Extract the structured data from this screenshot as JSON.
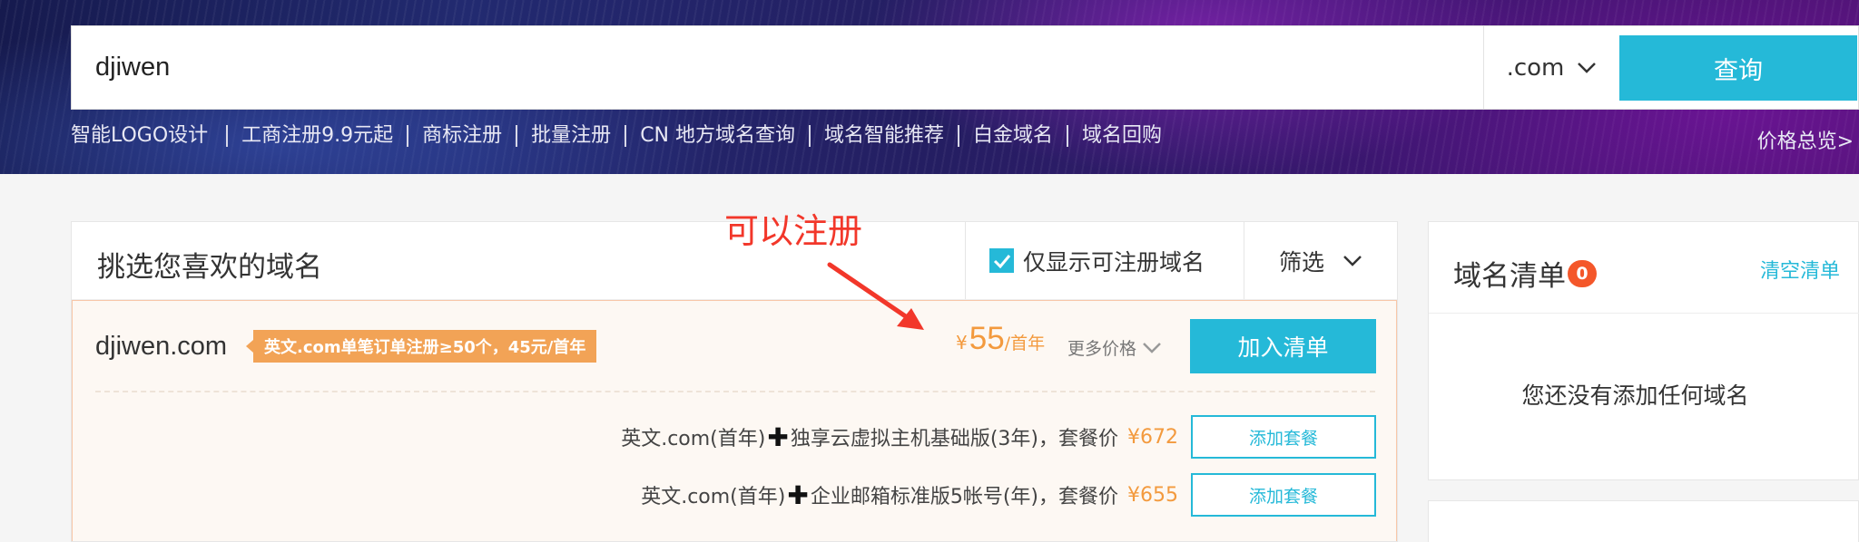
{
  "search": {
    "query": "djiwen",
    "tld": ".com",
    "button_label": "查询"
  },
  "quick_links": [
    "智能LOGO设计",
    "工商注册9.9元起",
    "商标注册",
    "批量注册",
    "CN 地方域名查询",
    "域名智能推荐",
    "白金域名",
    "域名回购"
  ],
  "price_overview": "价格总览>",
  "main": {
    "title": "挑选您喜欢的域名",
    "filter_checkbox_label": "仅显示可注册域名",
    "filter_checked": true,
    "filter_button": "筛选"
  },
  "result": {
    "domain": "djiwen.com",
    "promo": "英文.com单笔订单注册≥50个，45元/首年",
    "currency": "¥",
    "price": "55",
    "price_unit": "/首年",
    "more_price": "更多价格",
    "add_button": "加入清单",
    "bundles": [
      {
        "left": "英文.com(首年)",
        "plus": "✚",
        "right": "独享云虚拟主机基础版(3年)，套餐价",
        "price": "¥672",
        "button": "添加套餐"
      },
      {
        "left": "英文.com(首年)",
        "plus": "✚",
        "right": "企业邮箱标准版5帐号(年)，套餐价",
        "price": "¥655",
        "button": "添加套餐"
      }
    ]
  },
  "annotation": "可以注册",
  "cart": {
    "title": "域名清单",
    "count": "0",
    "clear": "清空清单",
    "empty_message": "您还没有添加任何域名"
  },
  "colors": {
    "accent": "#25b9d8",
    "price": "#f39a3e",
    "promo_badge": "#f2a356",
    "annotation": "#f2372a",
    "count_badge": "#f4572a"
  }
}
